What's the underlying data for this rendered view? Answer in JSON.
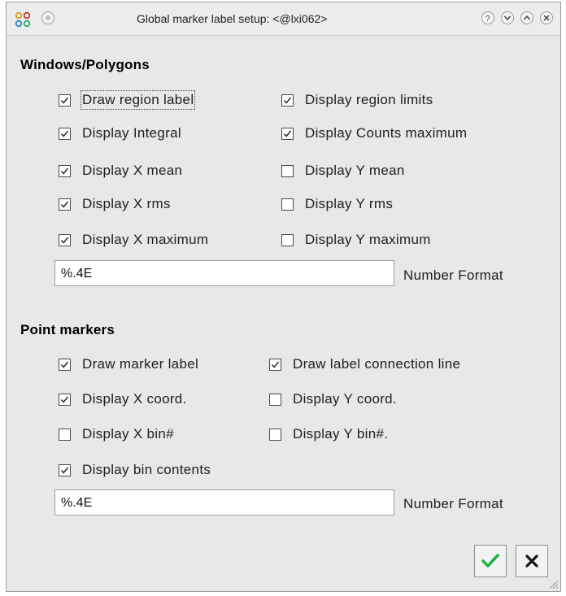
{
  "window": {
    "title": "Global marker label setup: <@lxi062>"
  },
  "sections": {
    "windows": "Windows/Polygons",
    "points": "Point markers"
  },
  "windows_options": [
    {
      "label": "Draw region label",
      "checked": true
    },
    {
      "label": "Display region limits",
      "checked": true
    },
    {
      "label": "Display Integral",
      "checked": true
    },
    {
      "label": "Display Counts maximum",
      "checked": true
    },
    {
      "label": "Display X mean",
      "checked": true
    },
    {
      "label": "Display Y mean",
      "checked": false
    },
    {
      "label": "Display X rms",
      "checked": true
    },
    {
      "label": "Display Y rms",
      "checked": false
    },
    {
      "label": "Display X maximum",
      "checked": true
    },
    {
      "label": "Display Y maximum",
      "checked": false
    }
  ],
  "points_options": [
    {
      "label": "Draw marker label",
      "checked": true
    },
    {
      "label": "Draw label connection line",
      "checked": true
    },
    {
      "label": "Display X coord.",
      "checked": true
    },
    {
      "label": "Display Y coord.",
      "checked": false
    },
    {
      "label": "Display X bin#",
      "checked": false
    },
    {
      "label": "Display Y bin#.",
      "checked": false
    },
    {
      "label": "Display bin contents",
      "checked": true
    }
  ],
  "windows_format": {
    "value": "%.4E",
    "label": "Number Format"
  },
  "points_format": {
    "value": "%.4E",
    "label": "Number Format"
  },
  "colors": {
    "ok_check": "#22b24a",
    "cancel_x": "#111111",
    "window_bg": "#e8e8e8"
  },
  "icons": {
    "ok": "checkmark-icon",
    "cancel": "x-icon"
  }
}
